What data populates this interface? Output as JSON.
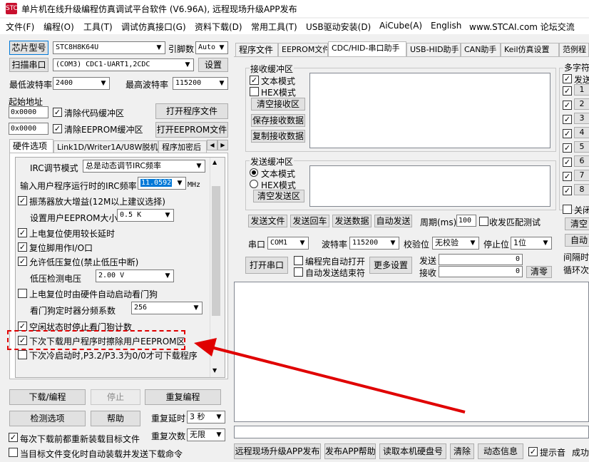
{
  "app": {
    "title": "单片机在线升级编程仿真调试平台软件 (V6.96A), 远程现场升级APP发布"
  },
  "menu": [
    "文件(F)",
    "编程(O)",
    "工具(T)",
    "调试仿真接口(G)",
    "资料下载(D)",
    "常用工具(T)",
    "USB驱动安装(D)",
    "AiCube(A)",
    "English",
    "www.STCAI.com 论坛交流"
  ],
  "left": {
    "chip_type_label": "芯片型号",
    "chip_type_value": "STC8H8K64U",
    "pin_label": "引脚数",
    "pin_value": "Auto",
    "scan_port_label": "扫描串口",
    "port_value": "(COM3) CDC1-UART1,2CDC",
    "settings_label": "设置",
    "min_baud_label": "最低波特率",
    "min_baud_value": "2400",
    "max_baud_label": "最高波特率",
    "max_baud_value": "115200",
    "start_addr_label": "起始地址",
    "addr1": "0x0000",
    "clear_code_label": "清除代码缓冲区",
    "open_program_label": "打开程序文件",
    "addr2": "0x0000",
    "clear_eeprom_label": "清除EEPROM缓冲区",
    "open_eeprom_label": "打开EEPROM文件",
    "tabs": [
      "硬件选项",
      "Link1D/Writer1A/U8W脱机",
      "程序加密后"
    ],
    "irc_mode_label": "IRC调节模式",
    "irc_mode_value": "总是动态调节IRC频率",
    "irc_freq_label": "输入用户程序运行时的IRC频率",
    "irc_freq_value": "11.0592",
    "irc_freq_unit": "MHz",
    "opt_osc_gain": "振荡器放大增益(12M以上建议选择)",
    "eeprom_size_label": "设置用户EEPROM大小",
    "eeprom_size_value": "0.5 K",
    "opt_long_delay": "上电复位使用较长延时",
    "opt_reset_io": "复位脚用作I/O口",
    "opt_lvr": "允许低压复位(禁止低压中断)",
    "lvd_label": "低压检测电压",
    "lvd_value": "2.00 V",
    "opt_wdt_auto": "上电复位时由硬件自动启动看门狗",
    "wdt_div_label": "看门狗定时器分频系数",
    "wdt_div_value": "256",
    "opt_idle_wdt": "空闲状态时停止看门狗计数",
    "opt_erase_eeprom": "下次下载用户程序时擦除用户EEPROM区",
    "opt_p32": "下次冷启动时,P3.2/P3.3为0/0才可下载程序",
    "download_label": "下载/编程",
    "stop_label": "停止",
    "reprogram_label": "重复编程",
    "check_label": "检测选项",
    "help_label": "帮助",
    "repeat_delay_label": "重复延时",
    "repeat_delay_value": "3 秒",
    "repeat_count_label": "重复次数",
    "repeat_count_value": "无限",
    "reload_label": "每次下载前都重新装载目标文件",
    "auto_load_label": "当目标文件变化时自动装载并发送下载命令"
  },
  "right": {
    "tabs": [
      "程序文件",
      "EEPROM文件",
      "CDC/HID-串口助手",
      "USB-HID助手",
      "CAN助手",
      "Keil仿真设置",
      "范例程"
    ],
    "recv_group": "接收缓冲区",
    "recv_text": "文本模式",
    "recv_hex": "HEX模式",
    "clear_recv": "清空接收区",
    "save_recv": "保存接收数据",
    "copy_recv": "复制接收数据",
    "send_group": "发送缓冲区",
    "send_text": "文本模式",
    "send_hex": "HEX模式",
    "clear_send": "清空发送区",
    "send_file": "发送文件",
    "send_enter": "发送回车",
    "send_data": "发送数据",
    "auto_send": "自动发送",
    "period_label": "周期(ms)",
    "period_value": "100",
    "match_label": "收发匹配测试",
    "port_label": "串口",
    "port_value": "COM1",
    "baud_label": "波特率",
    "baud_value": "115200",
    "parity_label": "校验位",
    "parity_value": "无校验",
    "stop_label": "停止位",
    "stop_value": "1位",
    "open_port": "打开串口",
    "auto_open": "编程完自动打开",
    "auto_send_end": "自动发送结束符",
    "more_settings": "更多设置",
    "send_count_label": "发送",
    "send_count": "0",
    "recv_count_label": "接收",
    "recv_count": "0",
    "clear_counts": "清零",
    "multi_label": "多字符",
    "multi_send": "发送",
    "multi_items": [
      "1",
      "2",
      "3",
      "4",
      "5",
      "6",
      "7",
      "8"
    ],
    "close_label": "关闭",
    "clear_all": "清空",
    "auto_loop": "自动",
    "interval_label": "间隔时",
    "loop_label": "循环次"
  },
  "bottom": {
    "remote_upgrade": "远程现场升级APP发布",
    "publish_help": "发布APP帮助",
    "read_disk": "读取本机硬盘号",
    "clear": "清除",
    "dynamic_info": "动态信息",
    "tip_sound": "提示音",
    "success": "成功"
  }
}
